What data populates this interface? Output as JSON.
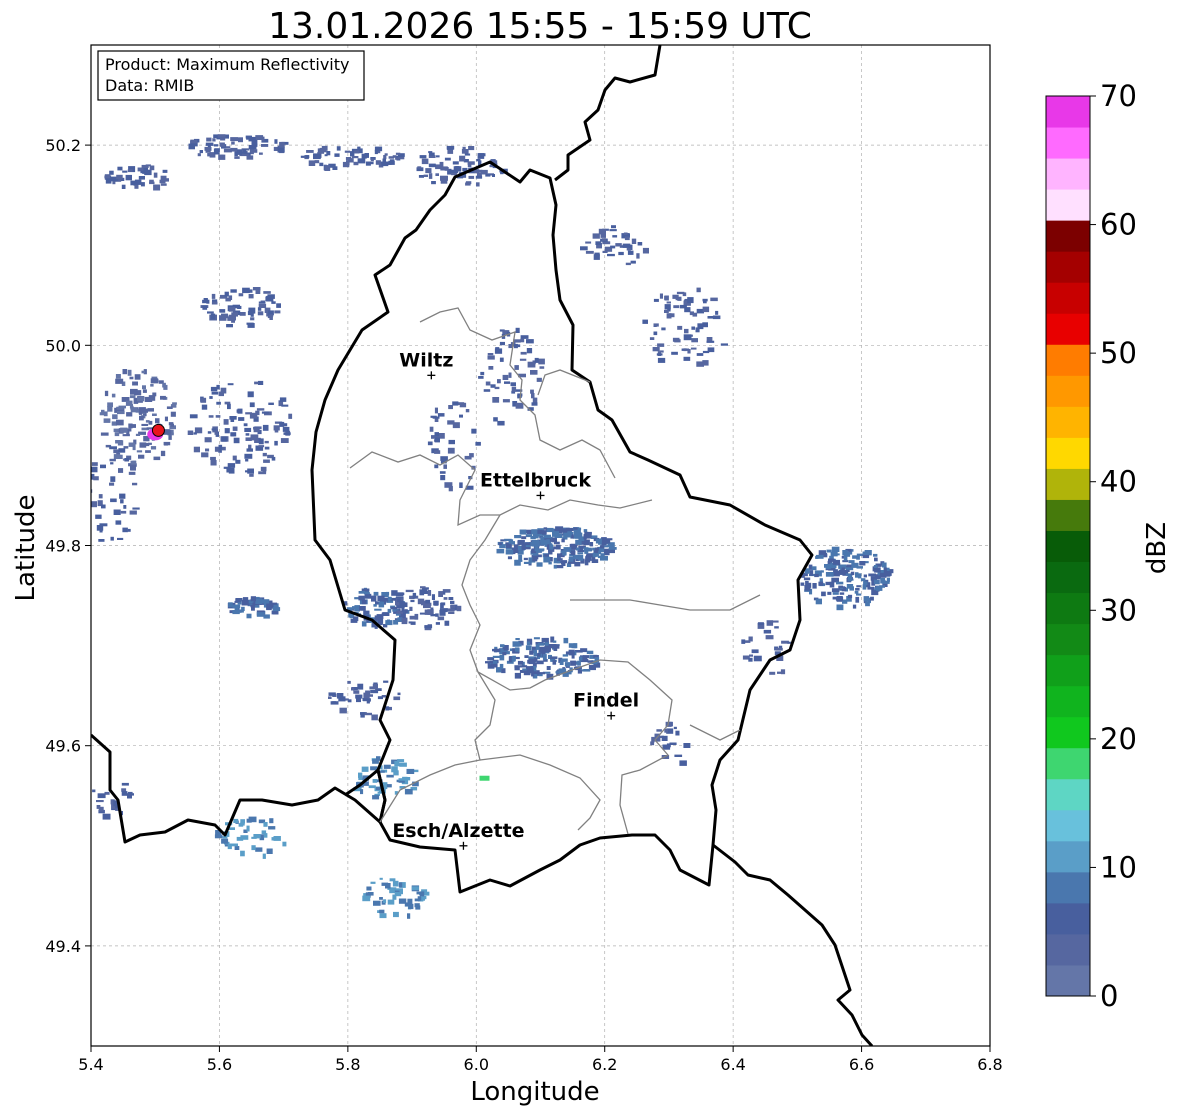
{
  "title": "13.01.2026 15:55 - 15:59 UTC",
  "info": {
    "product": "Product: Maximum Reflectivity",
    "source": "Data: RMIB"
  },
  "xlabel": "Longitude",
  "ylabel": "Latitude",
  "colorbar_label": "dBZ",
  "map": {
    "lon_range": [
      5.4,
      6.8
    ],
    "lat_range": [
      49.3,
      50.3
    ],
    "x_ticks": [
      5.4,
      5.6,
      5.8,
      6.0,
      6.2,
      6.4,
      6.6,
      6.8
    ],
    "y_ticks": [
      49.4,
      49.6,
      49.8,
      50.0,
      50.2
    ],
    "x_tick_labels": [
      "5.4",
      "5.6",
      "5.8",
      "6.0",
      "6.2",
      "6.4",
      "6.6",
      "6.8"
    ],
    "y_tick_labels": [
      "49.4",
      "49.6",
      "49.8",
      "50.0",
      "50.2"
    ],
    "grid": true,
    "cities": [
      {
        "name": "Wiltz",
        "lon": 5.93,
        "lat": 49.97
      },
      {
        "name": "Ettelbruck",
        "lon": 6.1,
        "lat": 49.85
      },
      {
        "name": "Findel",
        "lon": 6.21,
        "lat": 49.63
      },
      {
        "name": "Esch/Alzette",
        "lon": 5.98,
        "lat": 49.5
      }
    ],
    "radar_marker": {
      "lon": 5.505,
      "lat": 49.915,
      "color": "#e8141e"
    },
    "border_color": "#000000",
    "canton_color": "#808080"
  },
  "colorbar": {
    "min": 0,
    "max": 70,
    "step": 2.5,
    "tick_labels": [
      "0",
      "10",
      "20",
      "30",
      "40",
      "50",
      "60",
      "70"
    ],
    "colors": [
      "#6476a8",
      "#5667a0",
      "#485f9e",
      "#4a77ae",
      "#5a9ec8",
      "#68c1dc",
      "#5ed6c4",
      "#3ed670",
      "#10c81e",
      "#10b41e",
      "#10a01a",
      "#128a16",
      "#0e7a12",
      "#0a6a10",
      "#085c08",
      "#467a0c",
      "#b0b40a",
      "#ffd800",
      "#ffb400",
      "#ff9800",
      "#ff7c00",
      "#e80000",
      "#c80000",
      "#a40000",
      "#7c0000",
      "#ffe0ff",
      "#ffb4ff",
      "#ff6aff",
      "#e838e8"
    ]
  },
  "echoes": [
    {
      "lon": 5.48,
      "lat": 50.17,
      "rx": 0.06,
      "ry": 0.012,
      "c": 1,
      "n": 40
    },
    {
      "lon": 5.62,
      "lat": 50.2,
      "rx": 0.08,
      "ry": 0.012,
      "c": 1,
      "n": 70
    },
    {
      "lon": 5.8,
      "lat": 50.19,
      "rx": 0.08,
      "ry": 0.012,
      "c": 1,
      "n": 60
    },
    {
      "lon": 5.97,
      "lat": 50.18,
      "rx": 0.07,
      "ry": 0.02,
      "c": 1,
      "n": 70
    },
    {
      "lon": 5.47,
      "lat": 49.93,
      "rx": 0.06,
      "ry": 0.05,
      "c": 0,
      "n": 130
    },
    {
      "lon": 5.63,
      "lat": 49.92,
      "rx": 0.08,
      "ry": 0.05,
      "c": 1,
      "n": 110
    },
    {
      "lon": 5.63,
      "lat": 50.04,
      "rx": 0.06,
      "ry": 0.02,
      "c": 1,
      "n": 60
    },
    {
      "lon": 5.43,
      "lat": 49.85,
      "rx": 0.04,
      "ry": 0.05,
      "c": 1,
      "n": 40
    },
    {
      "lon": 6.12,
      "lat": 49.8,
      "rx": 0.09,
      "ry": 0.02,
      "c": 2,
      "n": 220
    },
    {
      "lon": 6.1,
      "lat": 49.69,
      "rx": 0.09,
      "ry": 0.02,
      "c": 2,
      "n": 160
    },
    {
      "lon": 5.84,
      "lat": 49.74,
      "rx": 0.05,
      "ry": 0.02,
      "c": 2,
      "n": 90
    },
    {
      "lon": 5.92,
      "lat": 49.74,
      "rx": 0.05,
      "ry": 0.02,
      "c": 1,
      "n": 60
    },
    {
      "lon": 5.65,
      "lat": 49.74,
      "rx": 0.04,
      "ry": 0.01,
      "c": 2,
      "n": 50
    },
    {
      "lon": 6.57,
      "lat": 49.77,
      "rx": 0.07,
      "ry": 0.03,
      "c": 2,
      "n": 160
    },
    {
      "lon": 6.32,
      "lat": 50.02,
      "rx": 0.07,
      "ry": 0.04,
      "c": 1,
      "n": 70
    },
    {
      "lon": 6.05,
      "lat": 49.97,
      "rx": 0.05,
      "ry": 0.05,
      "c": 1,
      "n": 60
    },
    {
      "lon": 5.96,
      "lat": 49.9,
      "rx": 0.04,
      "ry": 0.05,
      "c": 1,
      "n": 40
    },
    {
      "lon": 5.85,
      "lat": 49.57,
      "rx": 0.06,
      "ry": 0.02,
      "c": 3,
      "n": 50
    },
    {
      "lon": 5.87,
      "lat": 49.45,
      "rx": 0.05,
      "ry": 0.02,
      "c": 3,
      "n": 50
    },
    {
      "lon": 5.65,
      "lat": 49.51,
      "rx": 0.06,
      "ry": 0.02,
      "c": 3,
      "n": 40
    },
    {
      "lon": 5.43,
      "lat": 49.55,
      "rx": 0.03,
      "ry": 0.02,
      "c": 1,
      "n": 20
    },
    {
      "lon": 6.21,
      "lat": 50.1,
      "rx": 0.05,
      "ry": 0.02,
      "c": 1,
      "n": 40
    },
    {
      "lon": 5.82,
      "lat": 49.65,
      "rx": 0.06,
      "ry": 0.02,
      "c": 1,
      "n": 40
    },
    {
      "lon": 6.3,
      "lat": 49.6,
      "rx": 0.03,
      "ry": 0.03,
      "c": 1,
      "n": 20
    },
    {
      "lon": 6.45,
      "lat": 49.7,
      "rx": 0.04,
      "ry": 0.03,
      "c": 1,
      "n": 25
    }
  ],
  "strong_echoes": [
    {
      "lon": 6.005,
      "lat": 49.57,
      "c": 7
    }
  ],
  "radar_blob": {
    "lon": 5.5,
    "lat": 49.915,
    "color": "#e838e8"
  }
}
